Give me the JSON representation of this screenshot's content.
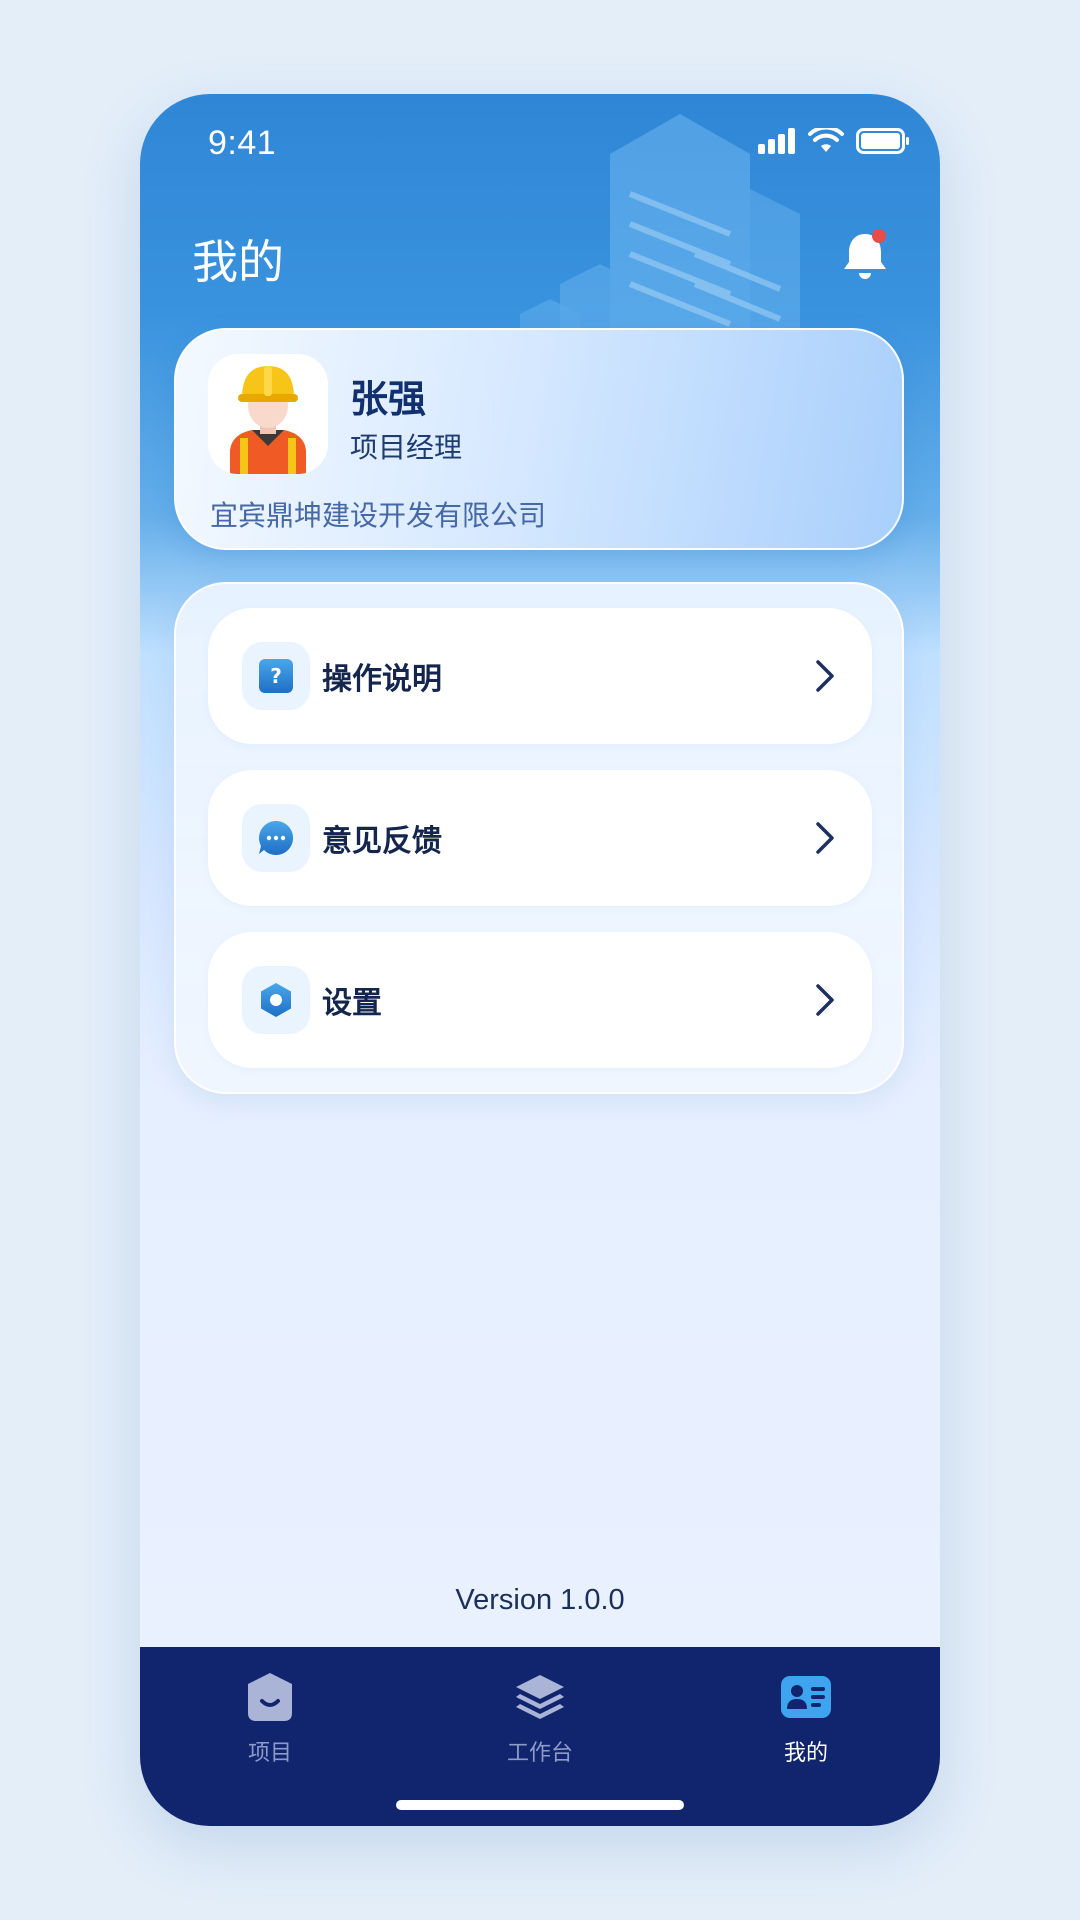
{
  "status_bar": {
    "time": "9:41"
  },
  "header": {
    "title": "我的"
  },
  "profile": {
    "name": "张强",
    "role": "项目经理",
    "company": "宜宾鼎坤建设开发有限公司"
  },
  "menu": {
    "items": [
      {
        "label": "操作说明",
        "icon": "help-icon"
      },
      {
        "label": "意见反馈",
        "icon": "feedback-icon"
      },
      {
        "label": "设置",
        "icon": "settings-icon"
      }
    ]
  },
  "footer": {
    "version": "Version 1.0.0"
  },
  "tabbar": {
    "items": [
      {
        "label": "项目",
        "icon": "project-icon",
        "active": false
      },
      {
        "label": "工作台",
        "icon": "layers-icon",
        "active": false
      },
      {
        "label": "我的",
        "icon": "profile-card-icon",
        "active": true
      }
    ]
  },
  "colors": {
    "accent": "#2f86d6",
    "tabbar_bg": "#11246e",
    "notification_dot": "#e84b4b"
  }
}
